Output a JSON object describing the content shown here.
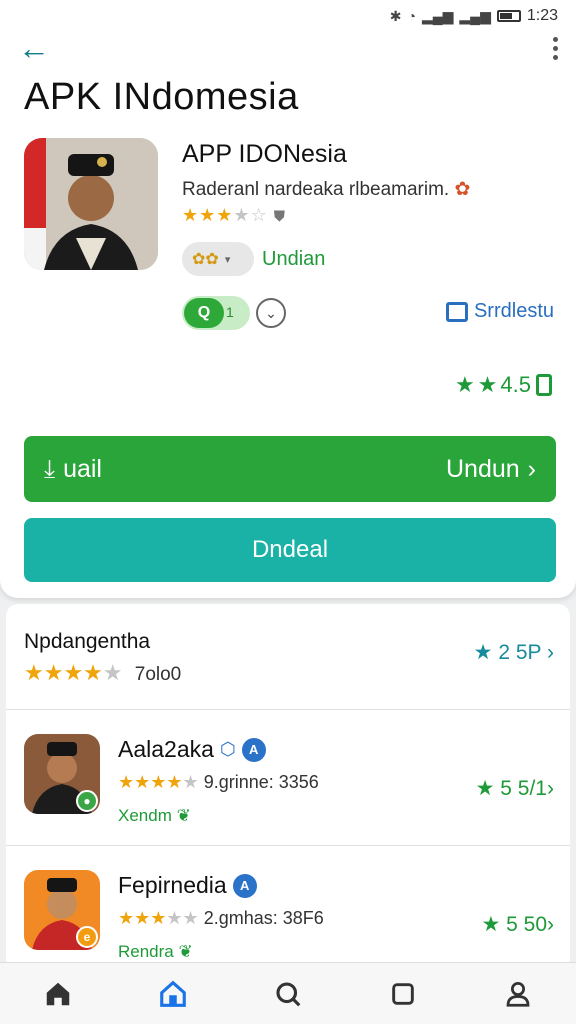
{
  "status_bar": {
    "time": "1:23",
    "icons": [
      "bluetooth-icon",
      "wifi-icon",
      "signal-icon",
      "signal-icon",
      "battery-icon"
    ]
  },
  "header": {
    "title": "APK INdomesia"
  },
  "app": {
    "name": "APP IDONesia",
    "subtitle": "Raderanl nardeaka rlbeamarim.",
    "rating_stars_filled": 3,
    "rating_stars_total": 5,
    "chip_label": "Undian",
    "toggle_label": "Q",
    "toggle_small": "1",
    "side_link_label": "Srrdlestu",
    "rating_display": "4.5",
    "primary_button": {
      "left": "uail",
      "right": "Undun"
    },
    "secondary_button": "Dndeal"
  },
  "summary": {
    "title": "Npdangentha",
    "stars_filled": 4,
    "count": "7olo0",
    "rating": "2 5P"
  },
  "rows": [
    {
      "name": "Aala2aka",
      "stars": 4,
      "meta": "9.grinne: 3356",
      "tag": "Xendm",
      "rating": "5 5/1",
      "badge_color": "#3aa646"
    },
    {
      "name": "Fepirnedia",
      "stars": 3,
      "meta": "2.gmhas: 38F6",
      "tag": "Rendra",
      "rating": "5 50",
      "badge_color": "#f39c12"
    }
  ],
  "nav": [
    "home-icon",
    "store-icon",
    "search-icon",
    "square-icon",
    "profile-icon"
  ],
  "colors": {
    "accent_green": "#2aa53a",
    "accent_teal": "#1ab1a6",
    "star": "#f0a40c"
  }
}
